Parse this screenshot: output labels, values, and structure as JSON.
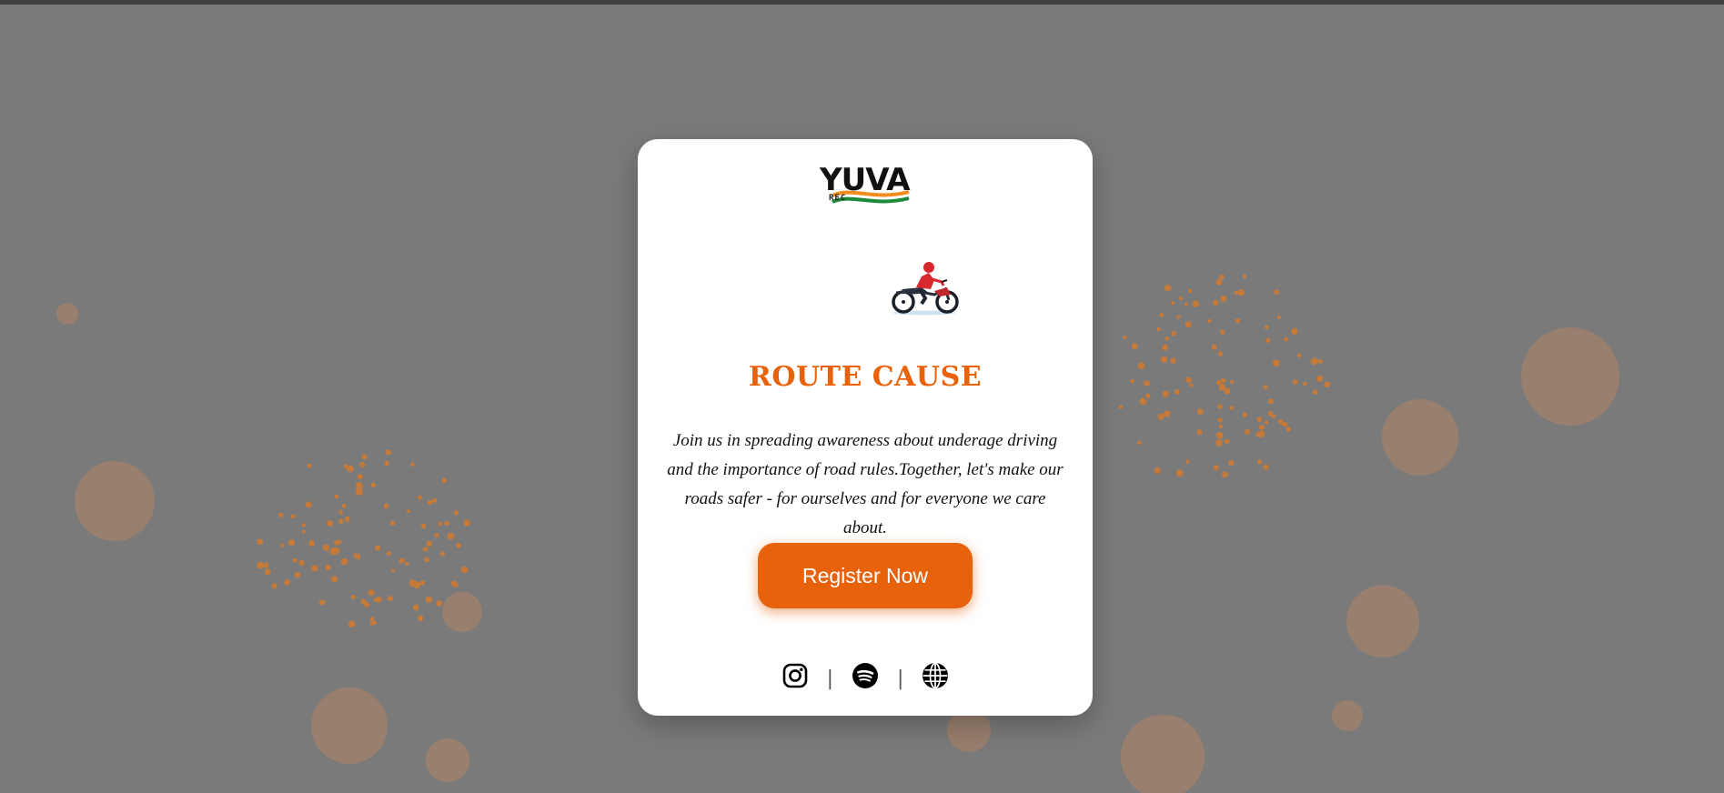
{
  "brand": {
    "logo_text": "YUVA",
    "logo_subtext": "REC"
  },
  "hero": {
    "title": "ROUTE CAUSE",
    "description": "Join us in spreading awareness about underage driving and the importance of road rules.Together, let's make our roads safer - for ourselves and for everyone we care about.",
    "register_label": "Register Now"
  },
  "social": {
    "separator": "|",
    "icons": [
      "instagram-icon",
      "spotify-icon",
      "globe-icon"
    ]
  },
  "colors": {
    "accent": "#e8620c",
    "overlay": "#7a7a7a",
    "card": "#ffffff"
  }
}
